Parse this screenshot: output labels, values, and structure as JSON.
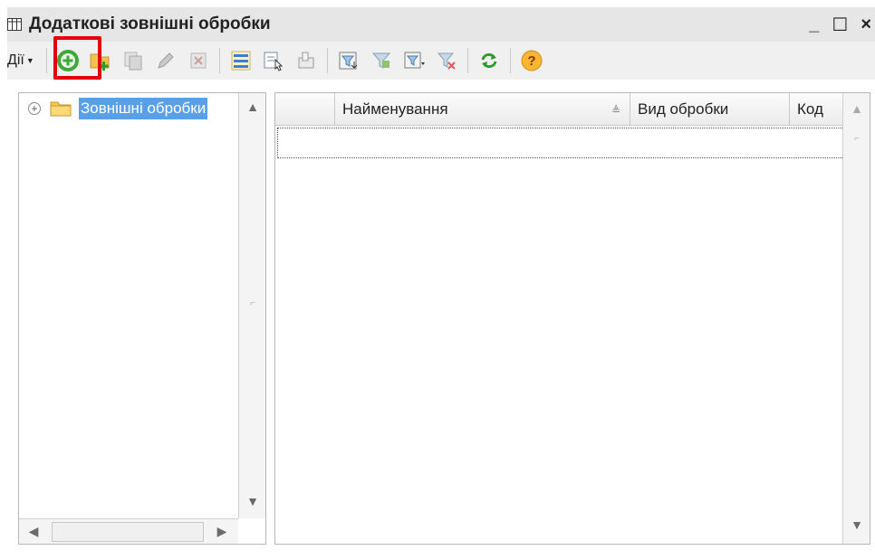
{
  "window": {
    "title": "Додаткові зовнішні обробки",
    "minimize_glyph": "_",
    "maximize_glyph": "☐",
    "close_glyph": "×"
  },
  "toolbar": {
    "actions_label": "Дії",
    "buttons": [
      "add-icon",
      "add-folder-icon",
      "copy-icon",
      "edit-icon",
      "delete-icon",
      "hierarchy-icon",
      "list-mode-icon",
      "select-icon",
      "filter-icon",
      "filter-apply-icon",
      "filter-menu-icon",
      "filter-clear-icon",
      "refresh-icon",
      "help-icon"
    ]
  },
  "tree": {
    "root_label": "Зовнішні обробки",
    "expander": "+"
  },
  "grid": {
    "columns": [
      "",
      "Найменування",
      "Вид обробки",
      "Код"
    ],
    "sort_indicator": "≜"
  },
  "colors": {
    "selection": "#5aa0e8",
    "highlight": "#e3000f",
    "title_bar": "#e6e6e6"
  }
}
